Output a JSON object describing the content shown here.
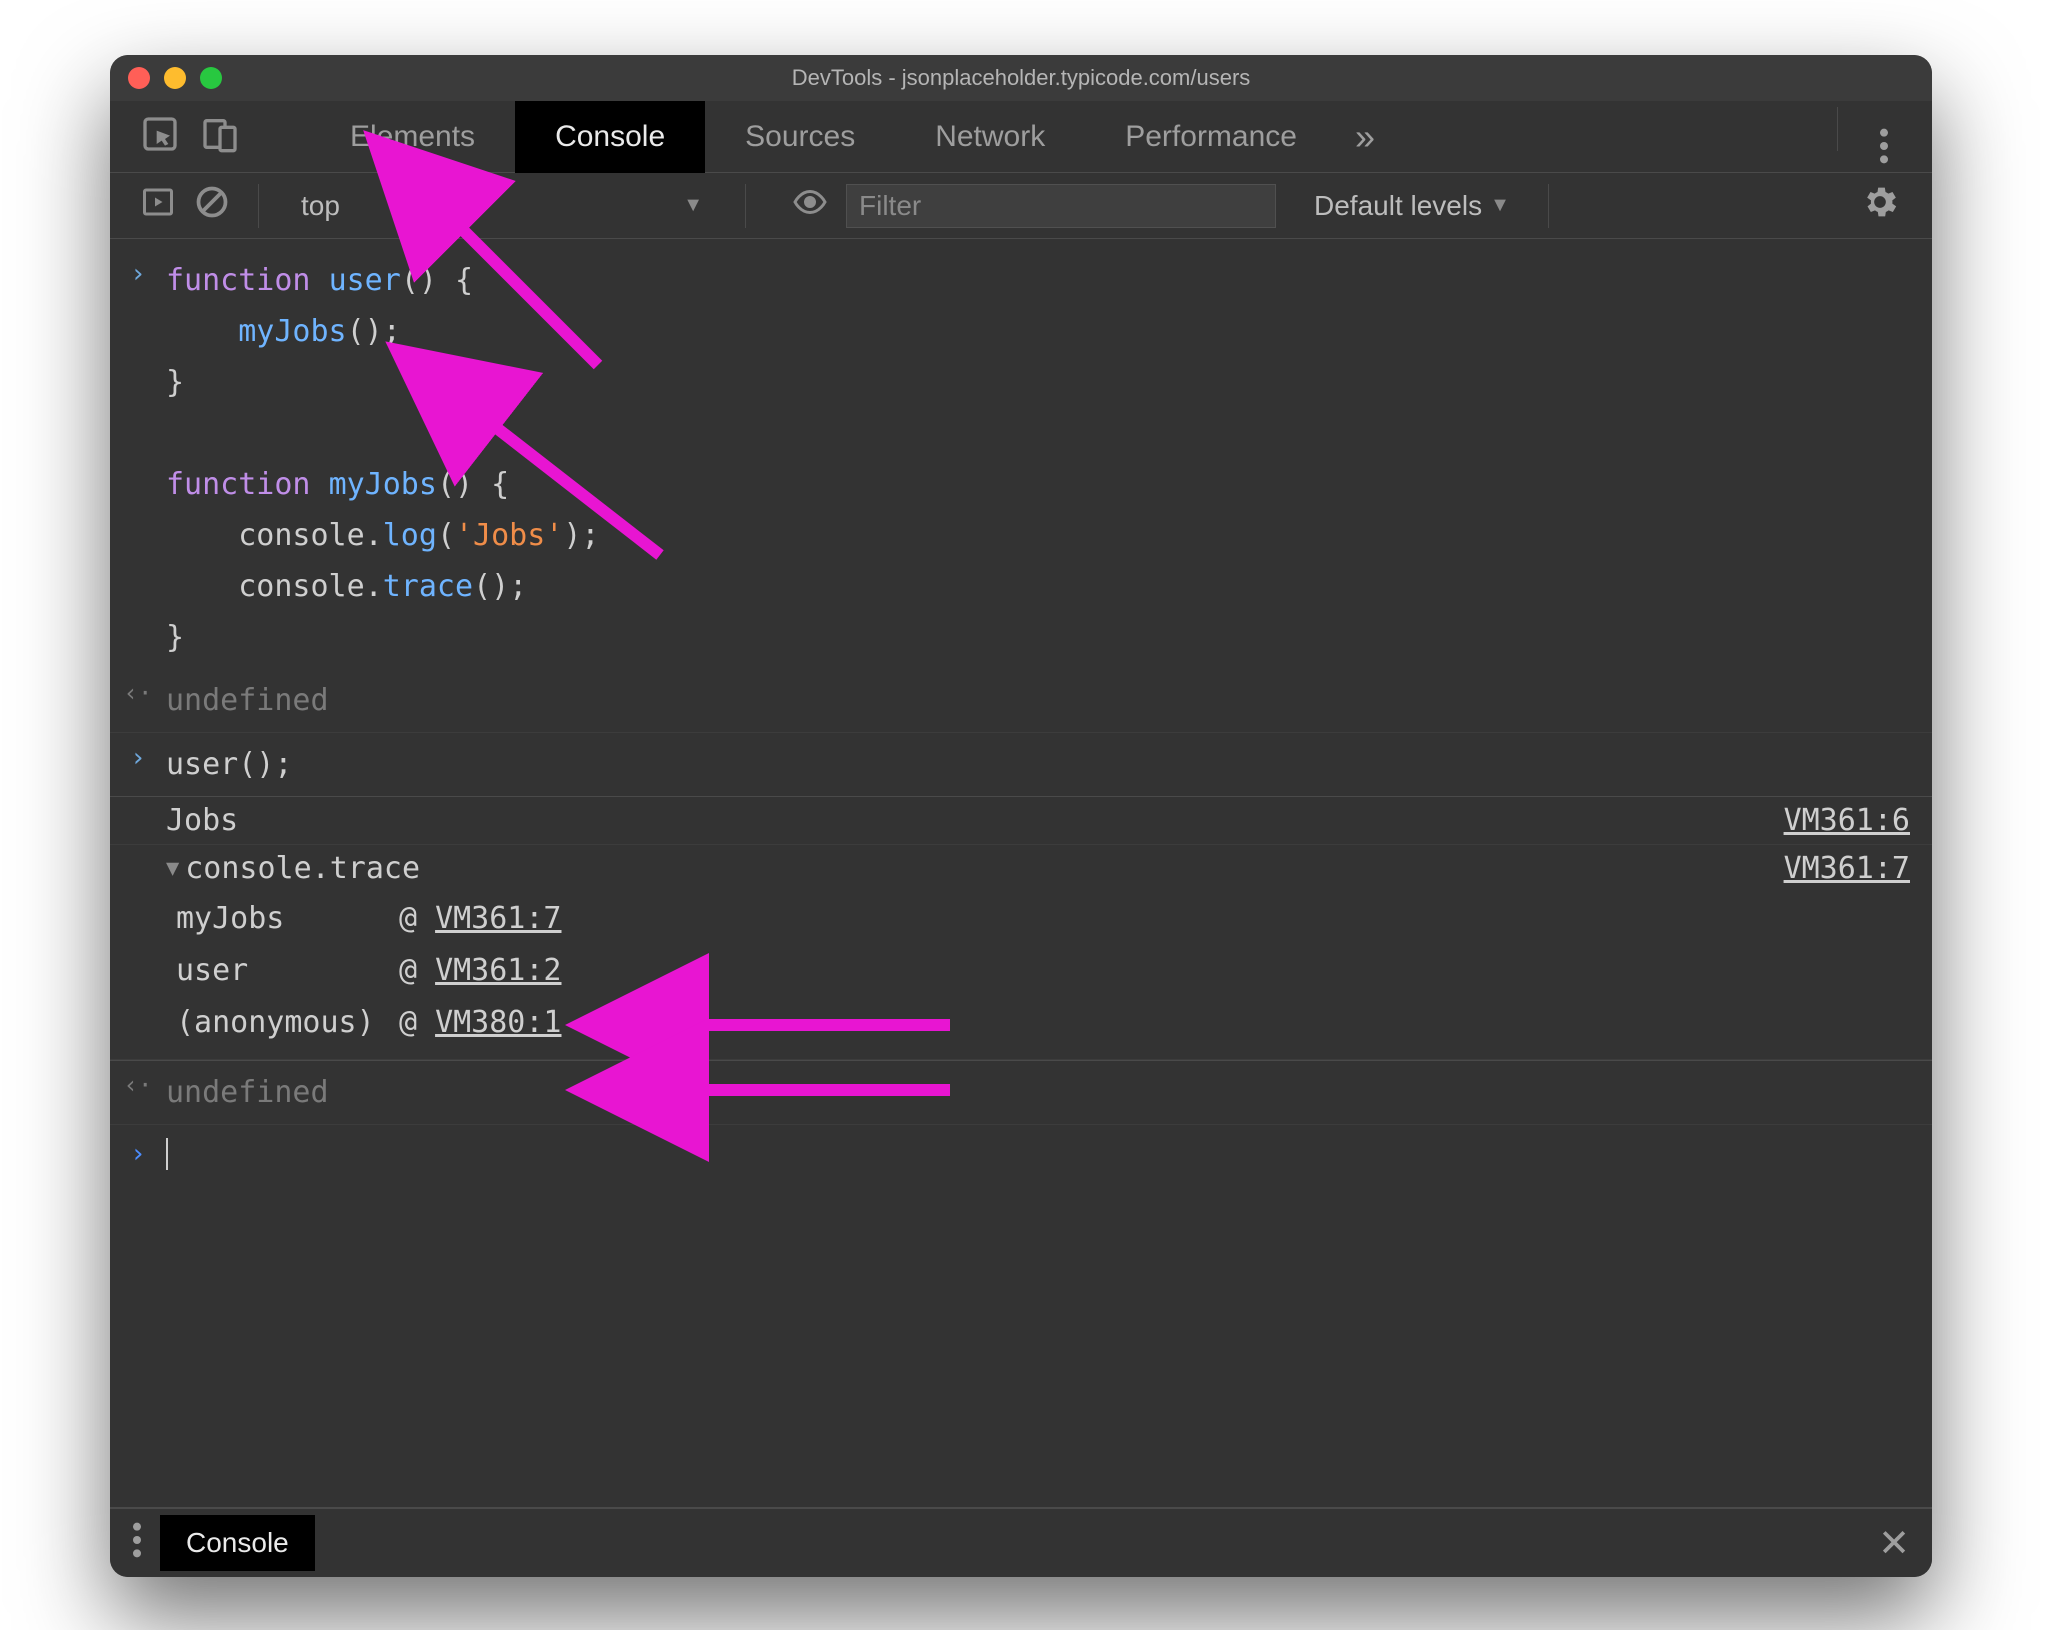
{
  "window": {
    "title": "DevTools - jsonplaceholder.typicode.com/users"
  },
  "tabs": {
    "elements": "Elements",
    "console": "Console",
    "sources": "Sources",
    "network": "Network",
    "performance": "Performance"
  },
  "toolbar": {
    "context": "top",
    "context_caret": "▼",
    "filter_placeholder": "Filter",
    "levels": "Default levels",
    "levels_caret": "▼"
  },
  "code": {
    "block1_line1_kw": "function",
    "block1_line1_fn": "user",
    "block1_line1_rest": "() {",
    "block1_line2_call": "myJobs",
    "block1_line2_rest": "();",
    "block1_line3": "}",
    "blank": "",
    "block2_line1_kw": "function",
    "block2_line1_fn": "myJobs",
    "block2_line1_rest": "() {",
    "block2_line2a": "console.",
    "block2_line2b": "log",
    "block2_line2c": "(",
    "block2_line2d": "'Jobs'",
    "block2_line2e": ");",
    "block2_line3a": "console.",
    "block2_line3b": "trace",
    "block2_line3c": "();",
    "block2_line4": "}"
  },
  "output": {
    "undefined1": "undefined",
    "call": "user();",
    "jobs_msg": "Jobs",
    "jobs_src": "VM361:6",
    "trace_label": "console.trace",
    "trace_src": "VM361:7",
    "stack": [
      {
        "fn": "myJobs",
        "loc": "VM361:7"
      },
      {
        "fn": "user",
        "loc": "VM361:2"
      },
      {
        "fn": "(anonymous)",
        "loc": "VM380:1"
      }
    ],
    "at": "@",
    "undefined2": "undefined"
  },
  "drawer": {
    "tab": "Console"
  },
  "glyphs": {
    "prompt_in": "›",
    "prompt_out": "‹·",
    "overflow": "»",
    "triangle_down": "▼",
    "close": "✕"
  }
}
